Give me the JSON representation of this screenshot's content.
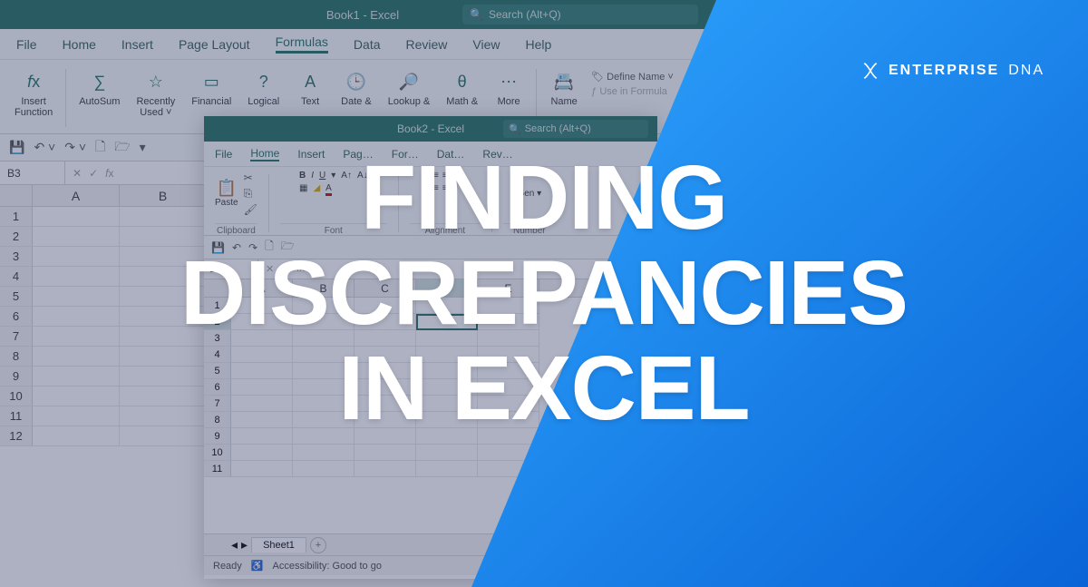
{
  "overlay": {
    "headline_l1": "FINDING",
    "headline_l2": "DISCREPANCIES",
    "headline_l3": "IN EXCEL",
    "brand_main": "ENTERPRISE",
    "brand_sub": "DNA"
  },
  "win1": {
    "title": "Book1 - Excel",
    "search_placeholder": "Search (Alt+Q)",
    "menu": [
      "File",
      "Home",
      "Insert",
      "Page Layout",
      "Formulas",
      "Data",
      "Review",
      "View",
      "Help"
    ],
    "menu_active": "Formulas",
    "ribbon": {
      "insert_function": "Insert\nFunction",
      "autosum": "AutoSum",
      "recent": "Recently\nUsed",
      "financial": "Financial",
      "logical": "Logical",
      "text": "Text",
      "date": "Date &",
      "lookup": "Lookup &",
      "math": "Math &",
      "more": "More",
      "name_mgr": "Name",
      "define_name": "Define Name",
      "use_formula": "Use in Formula"
    },
    "namebox": "B3",
    "cols": [
      "A",
      "B"
    ],
    "rows": [
      "1",
      "2",
      "3",
      "4",
      "5",
      "6",
      "7",
      "8",
      "9",
      "10",
      "11",
      "12"
    ]
  },
  "win2": {
    "title": "Book2 - Excel",
    "search_placeholder": "Search (Alt+Q)",
    "menu": [
      "File",
      "Home",
      "Insert",
      "Page Layout",
      "Formulas",
      "Data",
      "Review"
    ],
    "menu_active": "Home",
    "groups": {
      "clipboard": "Clipboard",
      "font": "Font",
      "alignment": "Alignment",
      "number": "Number"
    },
    "paste": "Paste",
    "namebox": "D2",
    "cols": [
      "A",
      "B",
      "C",
      "D",
      "E"
    ],
    "rows": [
      "1",
      "2",
      "3",
      "4",
      "5",
      "6",
      "7",
      "8",
      "9",
      "10",
      "11"
    ],
    "sheet": "Sheet1",
    "status_ready": "Ready",
    "accessibility": "Accessibility: Good to go"
  }
}
